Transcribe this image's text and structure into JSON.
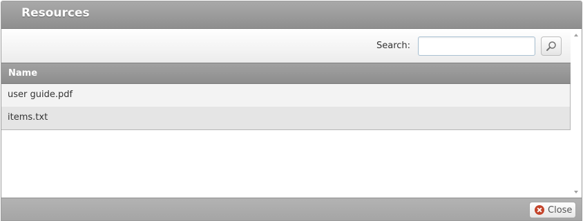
{
  "dialog": {
    "title": "Resources"
  },
  "search": {
    "label": "Search:",
    "value": "",
    "placeholder": ""
  },
  "grid": {
    "column_header": "Name",
    "rows": [
      {
        "name": "user guide.pdf"
      },
      {
        "name": "items.txt"
      }
    ]
  },
  "footer": {
    "close_label": "Close"
  },
  "icons": {
    "search": "magnifier-icon",
    "close": "close-circle-icon",
    "scroll_up": "scroll-up-arrow-icon",
    "scroll_down": "scroll-down-arrow-icon"
  }
}
